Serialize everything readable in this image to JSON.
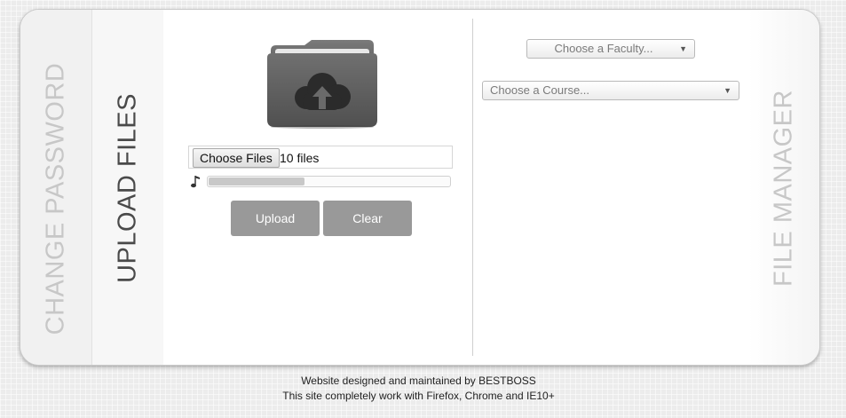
{
  "tabs": {
    "change_password": "CHANGE PASSWORD",
    "upload_files": "UPLOAD FILES",
    "file_manager": "FILE MANAGER"
  },
  "upload": {
    "choose_files_label": "Choose Files",
    "file_status": "10 files",
    "progress_fraction": 0.4,
    "upload_label": "Upload",
    "clear_label": "Clear",
    "icons": [
      "folder-upload-icon",
      "music-note-icon"
    ]
  },
  "file_manager": {
    "faculty_placeholder": "Choose a Faculty...",
    "course_placeholder": "Choose a Course..."
  },
  "footer": {
    "line1": "Website designed and maintained by BESTBOSS",
    "line2": "This site completely work with Firefox, Chrome and IE10+"
  },
  "colors": {
    "button_gray": "#999999",
    "active_tab_text": "#4a4a4a",
    "inactive_tab_text": "#c7c7c7"
  }
}
